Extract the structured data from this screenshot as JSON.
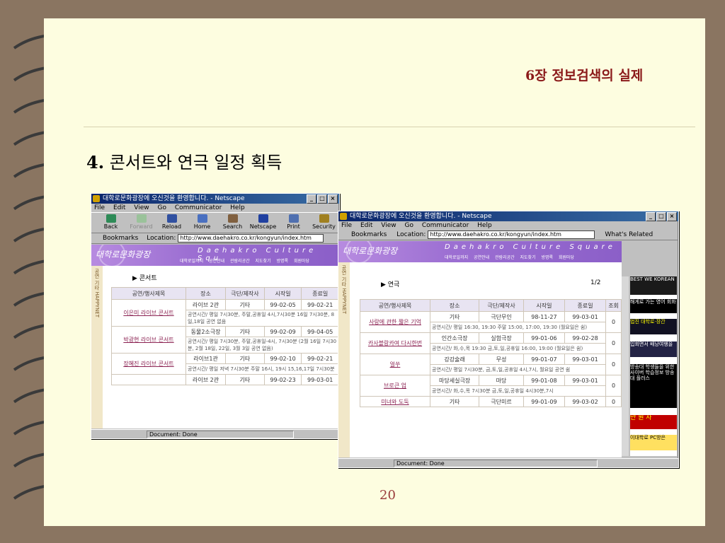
{
  "slide": {
    "chapter_title": "6장  정보검색의 실제",
    "heading_num": "4.",
    "heading_text": " 콘서트와 연극 일정 획득",
    "page_number": "20"
  },
  "win1": {
    "title": "대학로문화광장에 오신것을 환영합니다. - Netscape",
    "menus": [
      "File",
      "Edit",
      "View",
      "Go",
      "Communicator",
      "Help"
    ],
    "tools": [
      "Back",
      "Forward",
      "Reload",
      "Home",
      "Search",
      "Netscape",
      "Print",
      "Security"
    ],
    "bookmarks": "Bookmarks",
    "location_label": "Location:",
    "url": "http://www.daehakro.co.kr/kongyun/index.htm",
    "banner_logo": "대학로문화광장",
    "banner_eng": "Daehakro Culture Squ",
    "banner_nav": "대학로일까지 공연안내 관람리공간 지도찾기 방명록 회원마당",
    "section": "▶ 콘서트",
    "headers": [
      "공연/행사제목",
      "장소",
      "극단/제작사",
      "시작일",
      "종료일"
    ],
    "rows": [
      {
        "title": "이은미 라이브 콘서트",
        "place": "라이브 2관",
        "company": "기타",
        "start": "99-02-05",
        "end": "99-02-21",
        "desc": "공연시간/ 평일 7시30분, 주말,공휴일 4시,7시30분 16일 7시30분, 8일,18일 공연 없음"
      },
      {
        "title": "박광현 라이브 콘서트",
        "place": "동물2소극장",
        "company": "기타",
        "start": "99-02-09",
        "end": "99-04-05",
        "desc": "공연시간/ 평일 7시30분, 주말,공휴일-4시, 7시30분 (2월 16일 7시30분, 2월 18일, 22일, 3월 3일 공연 없음)"
      },
      {
        "title": "장혜진 라이브 콘서트",
        "place": "라이브1관",
        "company": "기타",
        "start": "99-02-10",
        "end": "99-02-21",
        "desc": "공연시간/ 평일 저녁 7시30분 주말 16시, 19시 15,16,17일 7시30분"
      },
      {
        "title": "",
        "place": "라이브 2관",
        "company": "기타",
        "start": "99-02-23",
        "end": "99-03-01",
        "desc": ""
      }
    ],
    "status": "Document: Done"
  },
  "win2": {
    "title": "대학로문화광장에 오신것을 환영합니다. - Netscape",
    "menus": [
      "File",
      "Edit",
      "View",
      "Go",
      "Communicator",
      "Help"
    ],
    "bookmarks": "Bookmarks",
    "location_label": "Location:",
    "url": "http://www.daehakro.co.kr/kongyun/index.htm",
    "related": "What's Related",
    "banner_logo": "대학로문화광장",
    "banner_eng": "Daehakro Culture Square",
    "banner_nav": "대학로일까지 공연안내 관람리공간 지도찾기 방명록 회원마당",
    "section": "▶ 연극",
    "page_indicator": "1/2",
    "headers": [
      "공연/행사제목",
      "장소",
      "극단/제작사",
      "시작일",
      "종료일",
      "조회"
    ],
    "rows": [
      {
        "title": "사랑에 관한 짧은 기억",
        "place": "기타",
        "company": "극단무인",
        "start": "98-11-27",
        "end": "99-03-01",
        "views": "0",
        "desc": "공연시간/ 평일 16:30, 19:30 주말 15:00, 17:00, 19:30 (월요일은 쉼)"
      },
      {
        "title": "카사블랑카여 다시한번",
        "place": "인간소극장",
        "company": "실험극장",
        "start": "99-01-06",
        "end": "99-02-28",
        "views": "0",
        "desc": "공연시간/ 화,수,목 19:30 금,토,일,공휴일 16:00, 19:00 (월요일은 쉼)"
      },
      {
        "title": "얼쑤",
        "place": "강강술래",
        "company": "무성",
        "start": "99-01-07",
        "end": "99-03-01",
        "views": "0",
        "desc": "공연시간/ 평일 7시30분, 금,토,일,공휴일 4시,7시, 월요일 공연 쉼"
      },
      {
        "title": "브로큰 업",
        "place": "마당세실극장",
        "company": "마당",
        "start": "99-01-08",
        "end": "99-03-01",
        "views": "0",
        "desc": "공연시간/ 화,수,목 7시30분 금,토,일,공휴일 4시30분,7시"
      },
      {
        "title": "미녀와 도둑",
        "place": "기타",
        "company": "극단미르",
        "start": "99-01-09",
        "end": "99-03-02",
        "views": "0",
        "desc": ""
      }
    ],
    "ads": [
      "BEST WE KOREAN",
      "해게로 가는 영어 회화",
      "법진 대학로·장간",
      "입회면서 배낭여행을",
      "방송대 학생들을 위한 사이버 학습정보 방송대 플러스",
      "만 원 사",
      "이대학로 PC방은"
    ],
    "status": "Document: Done"
  }
}
